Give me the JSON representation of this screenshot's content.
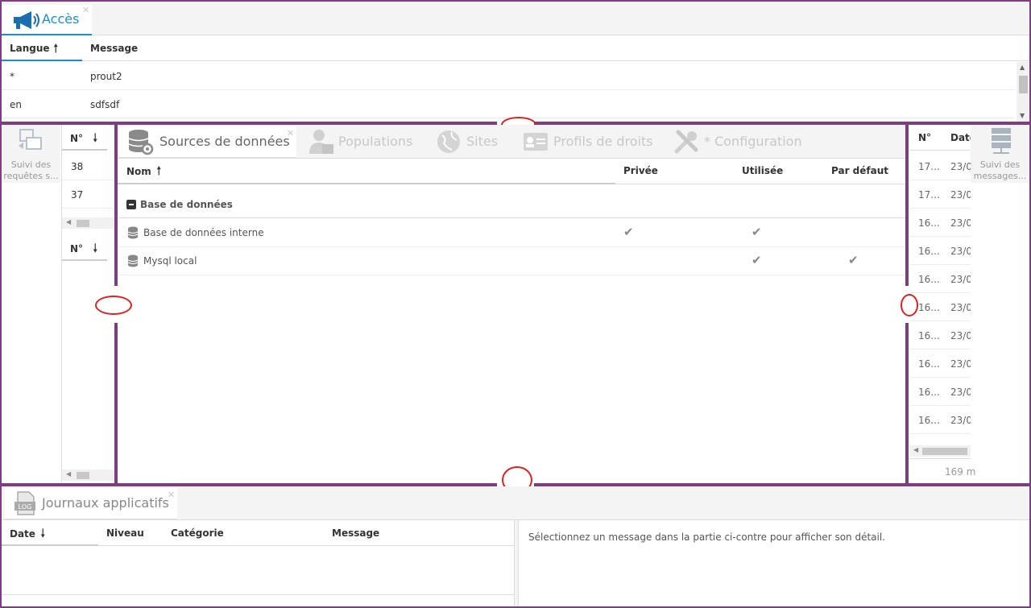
{
  "top_panel": {
    "tab_label": "Accès",
    "columns": [
      "Langue",
      "Message"
    ],
    "sort_icon": "arrow-up",
    "rows": [
      {
        "langue": "*",
        "message": "prout2"
      },
      {
        "langue": "en",
        "message": "sdfsdf"
      }
    ]
  },
  "left_rail": {
    "label": "Suivi des requêtes s...",
    "grid_header": "N°",
    "rows": [
      "38",
      "37"
    ],
    "grid2_header": "N°"
  },
  "center_panel": {
    "tabs": [
      {
        "label": "Sources de données",
        "icon": "database-gear-icon",
        "active": true
      },
      {
        "label": "Populations",
        "icon": "users-icon",
        "active": false
      },
      {
        "label": "Sites",
        "icon": "globe-icon",
        "active": false
      },
      {
        "label": "Profils de droits",
        "icon": "id-card-icon",
        "active": false
      },
      {
        "label": "* Configuration",
        "icon": "tools-icon",
        "active": false
      }
    ],
    "columns": [
      "Nom",
      "Privée",
      "Utilisée",
      "Par défaut"
    ],
    "group_label": "Base de données",
    "rows": [
      {
        "name": "Base de données interne",
        "privee": true,
        "utilisee": true,
        "defaut": false
      },
      {
        "name": "Mysql local",
        "privee": false,
        "utilisee": true,
        "defaut": true
      }
    ]
  },
  "right_rail": {
    "col_no": "N°",
    "col_date": "Date",
    "rows": [
      {
        "no": "17...",
        "date": "23/0"
      },
      {
        "no": "17...",
        "date": "23/0"
      },
      {
        "no": "16...",
        "date": "23/0"
      },
      {
        "no": "16...",
        "date": "23/0"
      },
      {
        "no": "16...",
        "date": "23/0"
      },
      {
        "no": "16...",
        "date": "23/0"
      },
      {
        "no": "16...",
        "date": "23/0"
      },
      {
        "no": "16...",
        "date": "23/0"
      },
      {
        "no": "16...",
        "date": "23/0"
      },
      {
        "no": "16...",
        "date": "23/0"
      }
    ],
    "footer": "169 m",
    "label": "Suivi des messages..."
  },
  "bottom_panel": {
    "tab_label": "Journaux applicatifs",
    "columns": [
      "Date",
      "Niveau",
      "Catégorie",
      "Message"
    ],
    "detail_text": "Sélectionnez un message dans la partie ci-contre pour afficher son détail."
  },
  "colors": {
    "splitter": "#7b3f7f",
    "accent": "#1a8fc9",
    "annotation": "#e02020"
  }
}
